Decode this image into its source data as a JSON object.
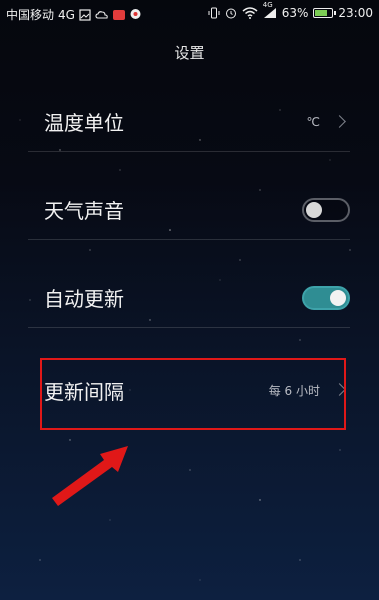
{
  "status_bar": {
    "carrier": "中国移动",
    "network": "4G",
    "signal_label": "4G",
    "battery": "63%",
    "battery_level": 0.63,
    "time": "23:00"
  },
  "page": {
    "title": "设置"
  },
  "settings": [
    {
      "label": "温度单位",
      "value": "℃",
      "control": "chevron"
    },
    {
      "label": "天气声音",
      "control": "toggle",
      "state": "off"
    },
    {
      "label": "自动更新",
      "control": "toggle",
      "state": "on"
    },
    {
      "label": "更新间隔",
      "value": "每 6 小时",
      "control": "chevron"
    }
  ],
  "colors": {
    "highlight_box": "#e01818",
    "toggle_on": "#2f8d93",
    "battery_fill": "#7ccc55"
  }
}
